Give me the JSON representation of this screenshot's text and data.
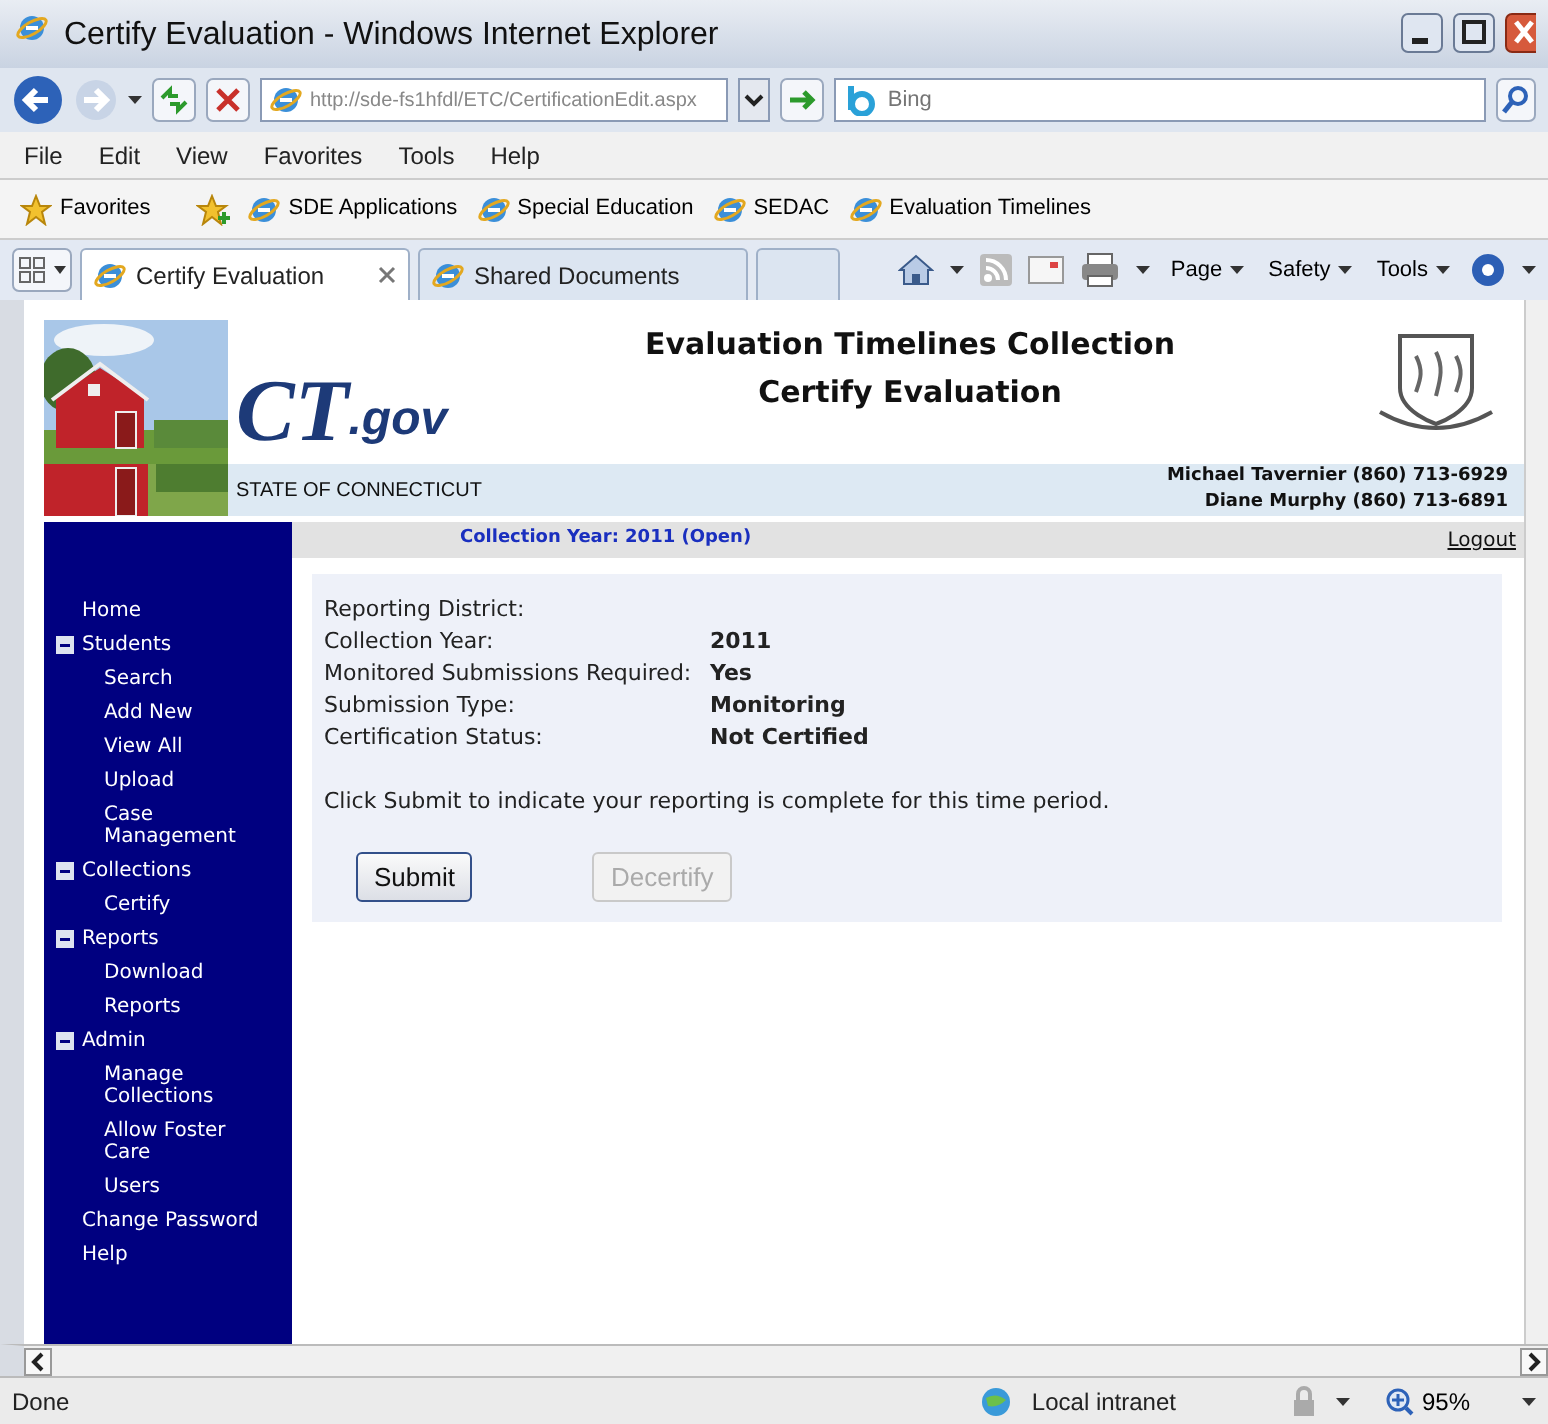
{
  "window": {
    "title": "Certify Evaluation - Windows Internet Explorer"
  },
  "address_bar": {
    "url": "http://sde-fs1hfdl/ETC/CertificationEdit.aspx",
    "search_placeholder": "Bing"
  },
  "menu": [
    "File",
    "Edit",
    "View",
    "Favorites",
    "Tools",
    "Help"
  ],
  "favorites": {
    "label": "Favorites",
    "links": [
      "SDE Applications",
      "Special Education",
      "SEDAC",
      "Evaluation Timelines"
    ]
  },
  "tabs": [
    {
      "label": "Certify Evaluation",
      "selected": true
    },
    {
      "label": "Shared Documents",
      "selected": false
    }
  ],
  "command_bar": [
    "Page",
    "Safety",
    "Tools"
  ],
  "page": {
    "logo": {
      "mark": "CT",
      "suffix": ".gov",
      "tagline": "STATE OF CONNECTICUT"
    },
    "titles": [
      "Evaluation Timelines Collection",
      "Certify Evaluation"
    ],
    "contacts": [
      "Michael Tavernier (860) 713-6929",
      "Diane Murphy (860) 713-6891"
    ],
    "collection_year": "Collection Year: 2011 (Open)",
    "logout": "Logout",
    "nav": [
      {
        "label": "Home"
      },
      {
        "label": "Students",
        "expanded": true,
        "children": [
          {
            "label": "Search"
          },
          {
            "label": "Add New"
          },
          {
            "label": "View All"
          },
          {
            "label": "Upload"
          },
          {
            "label": "Case Management"
          }
        ]
      },
      {
        "label": "Collections",
        "expanded": true,
        "children": [
          {
            "label": "Certify"
          }
        ]
      },
      {
        "label": "Reports",
        "expanded": true,
        "children": [
          {
            "label": "Download"
          },
          {
            "label": "Reports"
          }
        ]
      },
      {
        "label": "Admin",
        "expanded": true,
        "children": [
          {
            "label": "Manage Collections"
          },
          {
            "label": "Allow Foster Care"
          },
          {
            "label": "Users"
          }
        ]
      },
      {
        "label": "Change Password"
      },
      {
        "label": "Help"
      }
    ],
    "fields": [
      {
        "label": "Reporting District:"
      },
      {
        "label": "Collection Year:",
        "value": "2011"
      },
      {
        "label": "Monitored Submissions Required:",
        "value": "Yes"
      },
      {
        "label": "Submission Type:",
        "value": "Monitoring"
      },
      {
        "label": "Certification Status:",
        "value": "Not Certified"
      }
    ],
    "instruction": "Click Submit to indicate your reporting is complete for this time period.",
    "buttons": [
      {
        "label": "Submit",
        "disabled": false
      },
      {
        "label": "Decertify",
        "disabled": true
      }
    ]
  },
  "status_bar": {
    "text": "Done",
    "zone": "Local intranet",
    "zoom": "95%"
  }
}
